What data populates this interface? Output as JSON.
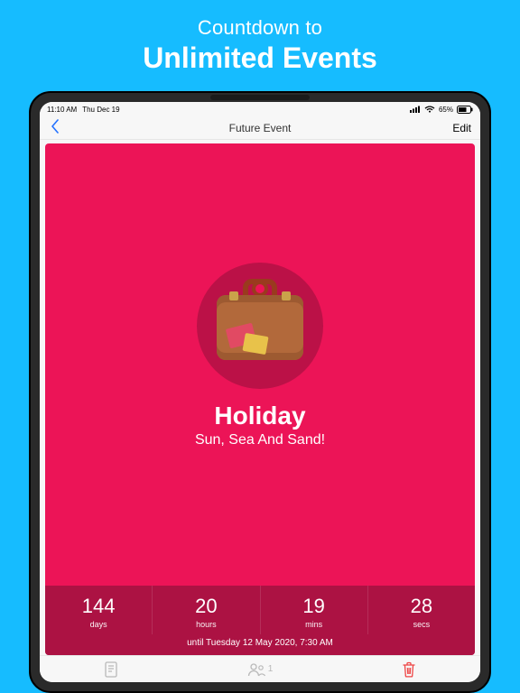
{
  "promo": {
    "subtitle": "Countdown to",
    "title": "Unlimited Events"
  },
  "statusbar": {
    "time": "11:10 AM",
    "date": "Thu Dec 19",
    "battery_pct": "65%"
  },
  "navbar": {
    "title": "Future Event",
    "edit": "Edit"
  },
  "event": {
    "icon": "suitcase-icon",
    "title": "Holiday",
    "subtitle": "Sun, Sea And Sand!",
    "until_line": "until Tuesday 12 May 2020, 7:30 AM"
  },
  "countdown": [
    {
      "value": "144",
      "label": "days"
    },
    {
      "value": "20",
      "label": "hours"
    },
    {
      "value": "19",
      "label": "mins"
    },
    {
      "value": "28",
      "label": "secs"
    }
  ],
  "tabs": {
    "shared_count": "1"
  },
  "colors": {
    "bg": "#16bcff",
    "card": "#ec1457",
    "card_dark": "#bb1147",
    "strip": "#ac1243",
    "accent_blue": "#2472ff"
  }
}
